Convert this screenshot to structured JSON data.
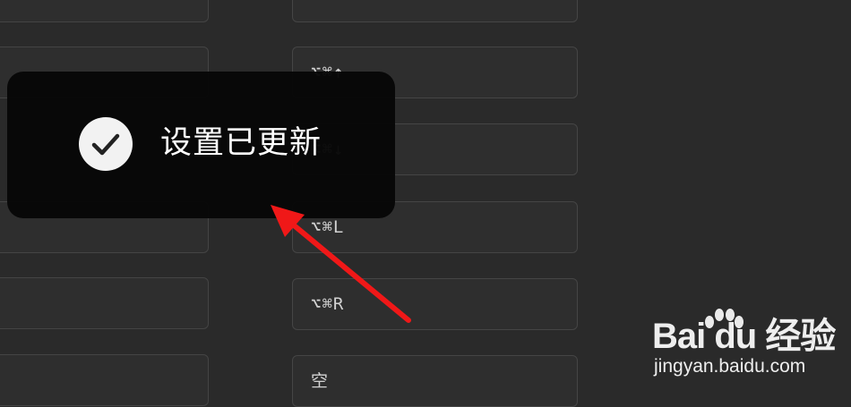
{
  "toast": {
    "message": "设置已更新",
    "icon": "check-circle-icon"
  },
  "shortcuts": [
    {
      "keys": "⌥⌘→"
    },
    {
      "keys": "⌥⌘↑"
    },
    {
      "keys": "⌥⌘↓"
    },
    {
      "keys": "⌥⌘L"
    },
    {
      "keys": "⌥⌘R"
    },
    {
      "keys": "空"
    }
  ],
  "annotation": {
    "color": "#f01818"
  },
  "watermark": {
    "brand": "Bai du 经验",
    "url": "jingyan.baidu.com"
  }
}
